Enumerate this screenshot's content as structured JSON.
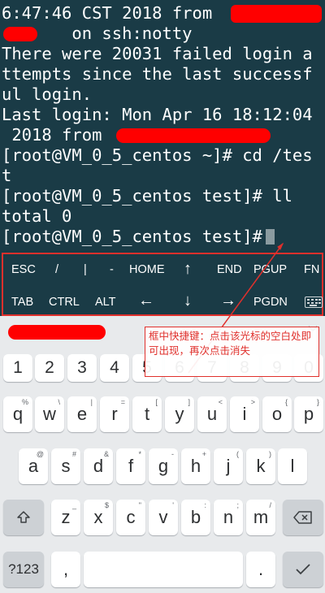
{
  "terminal": {
    "lines": [
      "6:47:46 CST 2018 from",
      "       on ssh:notty",
      "There were 20031 failed login a",
      "ttempts since the last successf",
      "ul login.",
      "Last login: Mon Apr 16 18:12:04",
      " 2018 from",
      "[root@VM_0_5_centos ~]# cd /tes",
      "t",
      "[root@VM_0_5_centos test]# ll",
      "total 0",
      "[root@VM_0_5_centos test]#"
    ]
  },
  "extra_keys": {
    "row1": [
      "ESC",
      "/",
      "|",
      "-",
      "HOME",
      "↑",
      "END",
      "PGUP",
      "FN"
    ],
    "row2": [
      "TAB",
      "CTRL",
      "ALT",
      "←",
      "↓",
      "→",
      "PGDN"
    ],
    "keyboard_toggle_icon": "keyboard-icon"
  },
  "keyboard": {
    "numbers": [
      "1",
      "2",
      "3",
      "4",
      "5",
      "6",
      "7",
      "8",
      "9",
      "0"
    ],
    "row1": [
      {
        "key": "q",
        "sub": "%"
      },
      {
        "key": "w",
        "sub": "\\"
      },
      {
        "key": "e",
        "sub": "|"
      },
      {
        "key": "r",
        "sub": "="
      },
      {
        "key": "t",
        "sub": "["
      },
      {
        "key": "y",
        "sub": "]"
      },
      {
        "key": "u",
        "sub": "<"
      },
      {
        "key": "i",
        "sub": ">"
      },
      {
        "key": "o",
        "sub": "{"
      },
      {
        "key": "p",
        "sub": "}"
      }
    ],
    "row2": [
      {
        "key": "a",
        "sub": "@"
      },
      {
        "key": "s",
        "sub": "#"
      },
      {
        "key": "d",
        "sub": "&"
      },
      {
        "key": "f",
        "sub": "*"
      },
      {
        "key": "g",
        "sub": "-"
      },
      {
        "key": "h",
        "sub": "+"
      },
      {
        "key": "j",
        "sub": "("
      },
      {
        "key": "k",
        "sub": ")"
      },
      {
        "key": "l",
        "sub": ""
      }
    ],
    "row3": [
      {
        "key": "z",
        "sub": "_"
      },
      {
        "key": "x",
        "sub": "$"
      },
      {
        "key": "c",
        "sub": "\""
      },
      {
        "key": "v",
        "sub": "'"
      },
      {
        "key": "b",
        "sub": ":"
      },
      {
        "key": "n",
        "sub": ";"
      },
      {
        "key": "m",
        "sub": "/"
      }
    ],
    "shift_icon": "shift-icon",
    "backspace_icon": "backspace-icon",
    "symbols_label": "?123",
    "comma": ",",
    "period": ".",
    "enter_icon": "enter-check-icon"
  },
  "annotation": {
    "text": "框中快捷键：点击该光标的空白处即可出现，再次点击消失"
  },
  "colors": {
    "terminal_bg": "#1a3b46",
    "terminal_text": "#ffffff",
    "highlight_red": "#e0302c",
    "keyboard_bg": "#e8eaec"
  }
}
